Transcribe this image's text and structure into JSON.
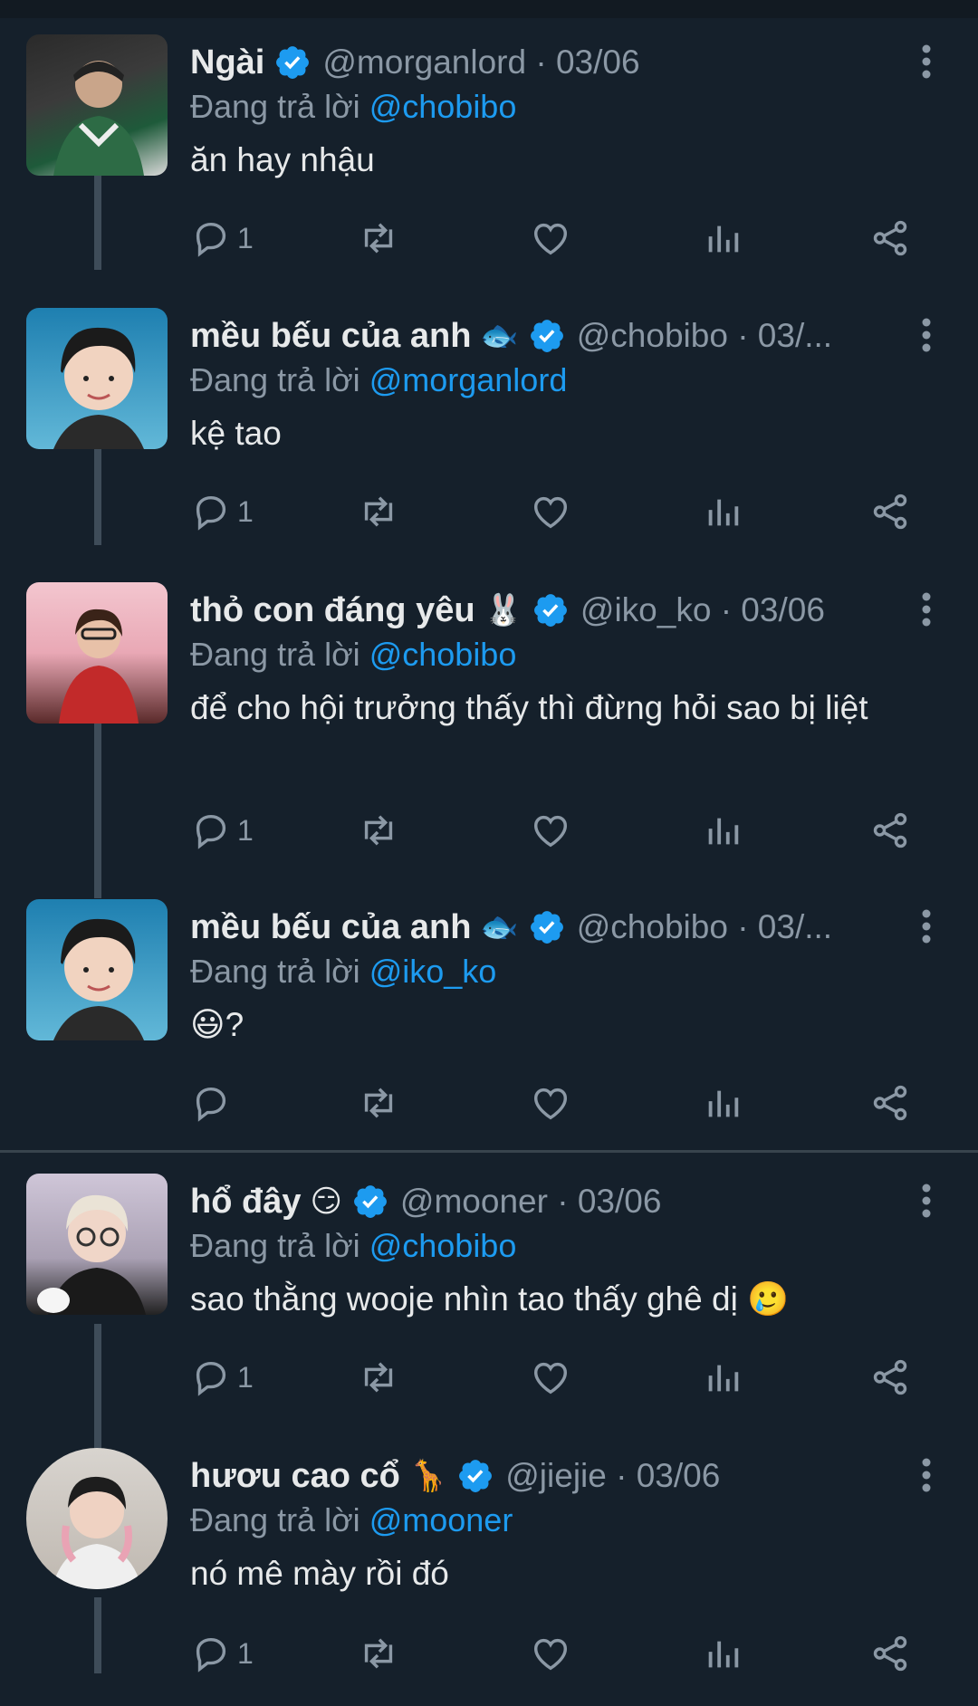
{
  "reply_prefix": "Đang trả lời",
  "tweets": [
    {
      "name": "Ngài",
      "name_emoji": "",
      "handle": "@morganlord · 03/06",
      "reply_to": "@chobibo",
      "text": "ăn hay nhậu",
      "reply_count": "1",
      "avatar_icon": "person-photo"
    },
    {
      "name": "mều bếu của anh",
      "name_emoji": "🐟",
      "handle": "@chobibo · 03/...",
      "reply_to": "@morganlord",
      "text": "kệ tao",
      "reply_count": "1",
      "avatar_icon": "person-photo"
    },
    {
      "name": "thỏ con đáng yêu",
      "name_emoji": "🐰",
      "handle": "@iko_ko · 03/06",
      "reply_to": "@chobibo",
      "text": "để cho hội trưởng thấy thì đừng hỏi sao bị liệt",
      "reply_count": "1",
      "avatar_icon": "person-photo"
    },
    {
      "name": "mều bếu của anh",
      "name_emoji": "🐟",
      "handle": "@chobibo · 03/...",
      "reply_to": "@iko_ko",
      "text": "😃?",
      "reply_count": "",
      "avatar_icon": "person-photo"
    },
    {
      "name": "hổ đây",
      "name_emoji": "😏",
      "handle": "@mooner · 03/06",
      "reply_to": "@chobibo",
      "text": "sao thằng wooje nhìn tao thấy ghê dị 🥲",
      "reply_count": "1",
      "avatar_icon": "person-photo"
    },
    {
      "name": "hươu cao cổ",
      "name_emoji": "🦒",
      "handle": "@jiejie · 03/06",
      "reply_to": "@mooner",
      "text": "nó mê mày rồi đó",
      "reply_count": "1",
      "avatar_icon": "person-photo"
    }
  ],
  "colors": {
    "background": "#15202b",
    "accent": "#1d9bf0",
    "muted": "#8b98a5",
    "text": "#e7e9ea"
  }
}
